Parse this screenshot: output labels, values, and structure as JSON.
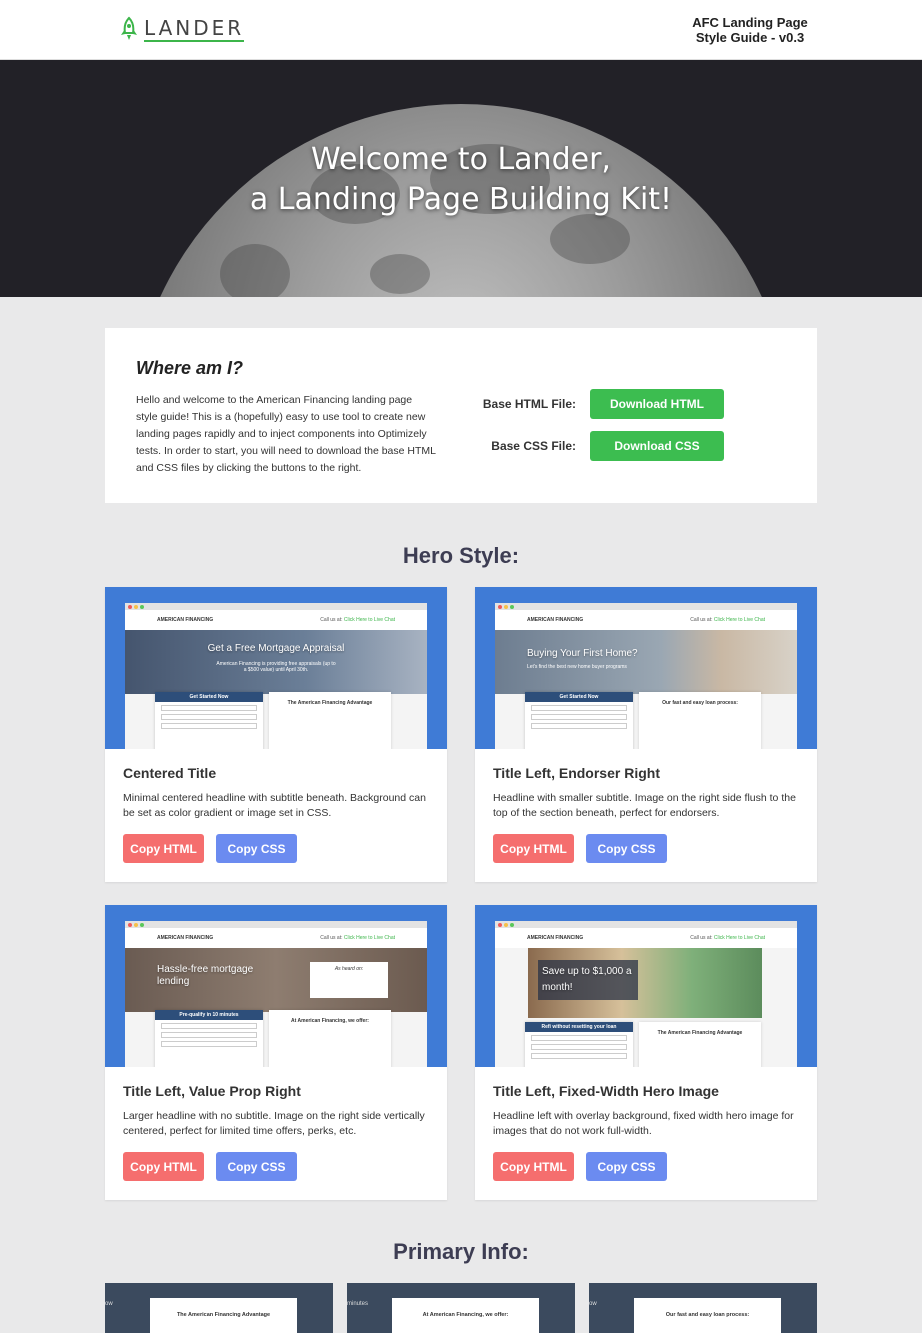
{
  "header": {
    "logo_text": "LANDER",
    "guide_title_line1": "AFC Landing Page",
    "guide_title_line2": "Style Guide - v0.3"
  },
  "hero": {
    "title_line1": "Welcome to Lander,",
    "title_line2": "a Landing Page Building Kit!"
  },
  "intro": {
    "heading": "Where am I?",
    "body": "Hello and welcome to the American Financing landing page style guide! This is a (hopefully) easy to use tool to create new landing pages rapidly and to inject components into Optimizely tests. In order to start, you will need to download the base HTML and CSS files by clicking the buttons to the right.",
    "html_label": "Base HTML File:",
    "html_button": "Download HTML",
    "css_label": "Base CSS File:",
    "css_button": "Download CSS"
  },
  "sections": {
    "hero_style": "Hero Style:",
    "primary_info": "Primary Info:"
  },
  "cards": [
    {
      "title": "Centered Title",
      "desc": "Minimal centered headline with subtitle beneath. Background can be set as color gradient or image set in CSS.",
      "copy_html": "Copy HTML",
      "copy_css": "Copy CSS",
      "preview_headline": "Get a Free Mortgage Appraisal",
      "preview_sub": "American Financing is providing free appraisals (up to a $500 value) until April 30th.",
      "preview_form": "Get Started Now",
      "preview_panel": "The American Financing Advantage"
    },
    {
      "title": "Title Left, Endorser Right",
      "desc": "Headline with smaller subtitle. Image on the right side flush to the top of the section beneath, perfect for endorsers.",
      "copy_html": "Copy HTML",
      "copy_css": "Copy CSS",
      "preview_headline": "Buying Your First Home?",
      "preview_sub": "Let's find the best new home buyer programs",
      "preview_form": "Get Started Now",
      "preview_panel": "Our fast and easy loan process:"
    },
    {
      "title": "Title Left, Value Prop Right",
      "desc": "Larger headline with no subtitle. Image on the right side vertically centered, perfect for limited time offers, perks, etc.",
      "copy_html": "Copy HTML",
      "copy_css": "Copy CSS",
      "preview_headline": "Hassle-free mortgage lending",
      "preview_sub": "As heard on:",
      "preview_form": "Pre-qualify in 10 minutes",
      "preview_panel": "At American Financing, we offer:"
    },
    {
      "title": "Title Left, Fixed-Width Hero Image",
      "desc": "Headline left with overlay background, fixed width hero image for images that do not work full-width.",
      "copy_html": "Copy HTML",
      "copy_css": "Copy CSS",
      "preview_headline": "Save up to $1,000 a month!",
      "preview_sub": "",
      "preview_form": "Refi without resetting your loan",
      "preview_panel": "The American Financing Advantage"
    }
  ],
  "preview_common": {
    "brand": "AMERICAN FINANCING",
    "call_label": "Call us at:",
    "chat_link": "Click Here to Live Chat"
  },
  "primary_info": [
    {
      "side": "ow",
      "panel": "The American Financing Advantage"
    },
    {
      "side": "minutes",
      "panel": "At American Financing, we offer:"
    },
    {
      "side": "ow",
      "panel": "Our fast and easy loan process:"
    }
  ],
  "colors": {
    "green": "#3cbd50",
    "red": "#f56e6e",
    "blue": "#6b8bf0",
    "thumb_blue": "#3f7bd6",
    "heading": "#3d3d53"
  }
}
